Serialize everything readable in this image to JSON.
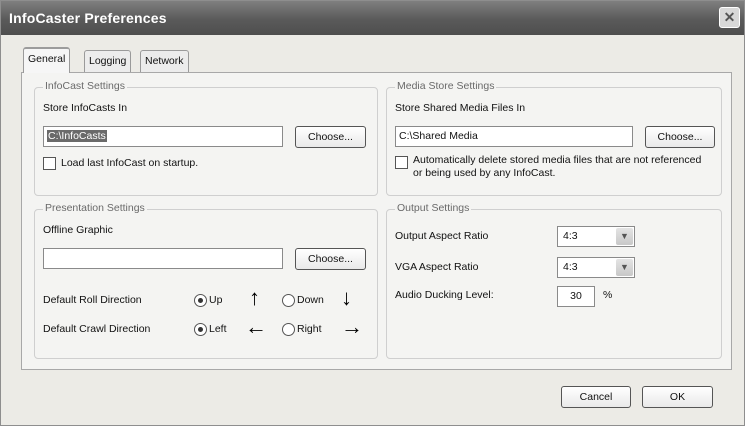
{
  "window": {
    "title": "InfoCaster Preferences",
    "close_glyph": "✕"
  },
  "tabs": [
    {
      "label": "General",
      "active": true
    },
    {
      "label": "Logging",
      "active": false
    },
    {
      "label": "Network",
      "active": false
    }
  ],
  "infocast_settings": {
    "legend": "InfoCast Settings",
    "store_label": "Store InfoCasts In",
    "store_value": "C:\\InfoCasts",
    "choose_label": "Choose...",
    "load_last_label": "Load last InfoCast on startup.",
    "load_last_checked": false
  },
  "media_store_settings": {
    "legend": "Media Store Settings",
    "store_label": "Store Shared Media Files In",
    "store_value": "C:\\Shared Media",
    "choose_label": "Choose...",
    "auto_delete_label": "Automatically delete stored media files that are not referenced or being used by any InfoCast.",
    "auto_delete_checked": false
  },
  "presentation_settings": {
    "legend": "Presentation Settings",
    "offline_graphic_label": "Offline Graphic",
    "offline_graphic_value": "",
    "choose_label": "Choose...",
    "roll_label": "Default Roll Direction",
    "roll_options": [
      {
        "label": "Up",
        "checked": true,
        "arrow": "↑"
      },
      {
        "label": "Down",
        "checked": false,
        "arrow": "↓"
      }
    ],
    "crawl_label": "Default Crawl Direction",
    "crawl_options": [
      {
        "label": "Left",
        "checked": true,
        "arrow": "←"
      },
      {
        "label": "Right",
        "checked": false,
        "arrow": "→"
      }
    ]
  },
  "output_settings": {
    "legend": "Output Settings",
    "aspect_label": "Output Aspect Ratio",
    "aspect_value": "4:3",
    "vga_label": "VGA Aspect Ratio",
    "vga_value": "4:3",
    "ducking_label": "Audio Ducking Level:",
    "ducking_value": "30",
    "ducking_unit": "%"
  },
  "footer": {
    "cancel_label": "Cancel",
    "ok_label": "OK"
  }
}
